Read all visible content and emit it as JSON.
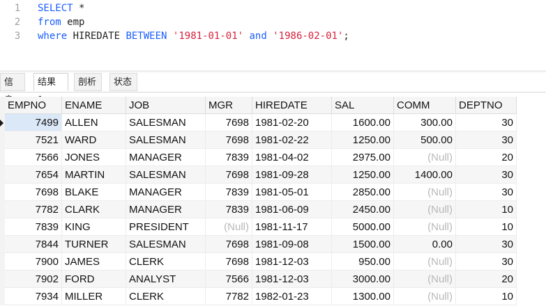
{
  "editor": {
    "lines": [
      {
        "num": "1",
        "tokens": [
          {
            "t": "SELECT",
            "k": "kw"
          },
          {
            "t": " *",
            "k": ""
          }
        ]
      },
      {
        "num": "2",
        "tokens": [
          {
            "t": "from",
            "k": "kw"
          },
          {
            "t": " emp",
            "k": ""
          }
        ]
      },
      {
        "num": "3",
        "tokens": [
          {
            "t": "where",
            "k": "kw"
          },
          {
            "t": " HIREDATE ",
            "k": ""
          },
          {
            "t": "BETWEEN",
            "k": "kw"
          },
          {
            "t": " ",
            "k": ""
          },
          {
            "t": "'1981-01-01'",
            "k": "str"
          },
          {
            "t": " ",
            "k": ""
          },
          {
            "t": "and",
            "k": "kw"
          },
          {
            "t": " ",
            "k": ""
          },
          {
            "t": "'1986-02-01'",
            "k": "str"
          },
          {
            "t": ";",
            "k": ""
          }
        ]
      }
    ]
  },
  "tabs": [
    {
      "label": "信息",
      "active": false
    },
    {
      "label": "结果 1",
      "active": true
    },
    {
      "label": "剖析",
      "active": false
    },
    {
      "label": "状态",
      "active": false
    }
  ],
  "grid": {
    "null_text": "(Null)",
    "columns": [
      {
        "label": "EMPNO",
        "align": "num"
      },
      {
        "label": "ENAME",
        "align": "txt"
      },
      {
        "label": "JOB",
        "align": "txt"
      },
      {
        "label": "MGR",
        "align": "num"
      },
      {
        "label": "HIREDATE",
        "align": "txt"
      },
      {
        "label": "SAL",
        "align": "num"
      },
      {
        "label": "COMM",
        "align": "num"
      },
      {
        "label": "DEPTNO",
        "align": "num"
      }
    ],
    "rows": [
      [
        "7499",
        "ALLEN",
        "SALESMAN",
        "7698",
        "1981-02-20",
        "1600.00",
        "300.00",
        "30"
      ],
      [
        "7521",
        "WARD",
        "SALESMAN",
        "7698",
        "1981-02-22",
        "1250.00",
        "500.00",
        "30"
      ],
      [
        "7566",
        "JONES",
        "MANAGER",
        "7839",
        "1981-04-02",
        "2975.00",
        null,
        "20"
      ],
      [
        "7654",
        "MARTIN",
        "SALESMAN",
        "7698",
        "1981-09-28",
        "1250.00",
        "1400.00",
        "30"
      ],
      [
        "7698",
        "BLAKE",
        "MANAGER",
        "7839",
        "1981-05-01",
        "2850.00",
        null,
        "30"
      ],
      [
        "7782",
        "CLARK",
        "MANAGER",
        "7839",
        "1981-06-09",
        "2450.00",
        null,
        "10"
      ],
      [
        "7839",
        "KING",
        "PRESIDENT",
        null,
        "1981-11-17",
        "5000.00",
        null,
        "10"
      ],
      [
        "7844",
        "TURNER",
        "SALESMAN",
        "7698",
        "1981-09-08",
        "1500.00",
        "0.00",
        "30"
      ],
      [
        "7900",
        "JAMES",
        "CLERK",
        "7698",
        "1981-12-03",
        "950.00",
        null,
        "30"
      ],
      [
        "7902",
        "FORD",
        "ANALYST",
        "7566",
        "1981-12-03",
        "3000.00",
        null,
        "20"
      ],
      [
        "7934",
        "MILLER",
        "CLERK",
        "7782",
        "1982-01-23",
        "1300.00",
        null,
        "10"
      ]
    ],
    "selected_row": 0
  }
}
